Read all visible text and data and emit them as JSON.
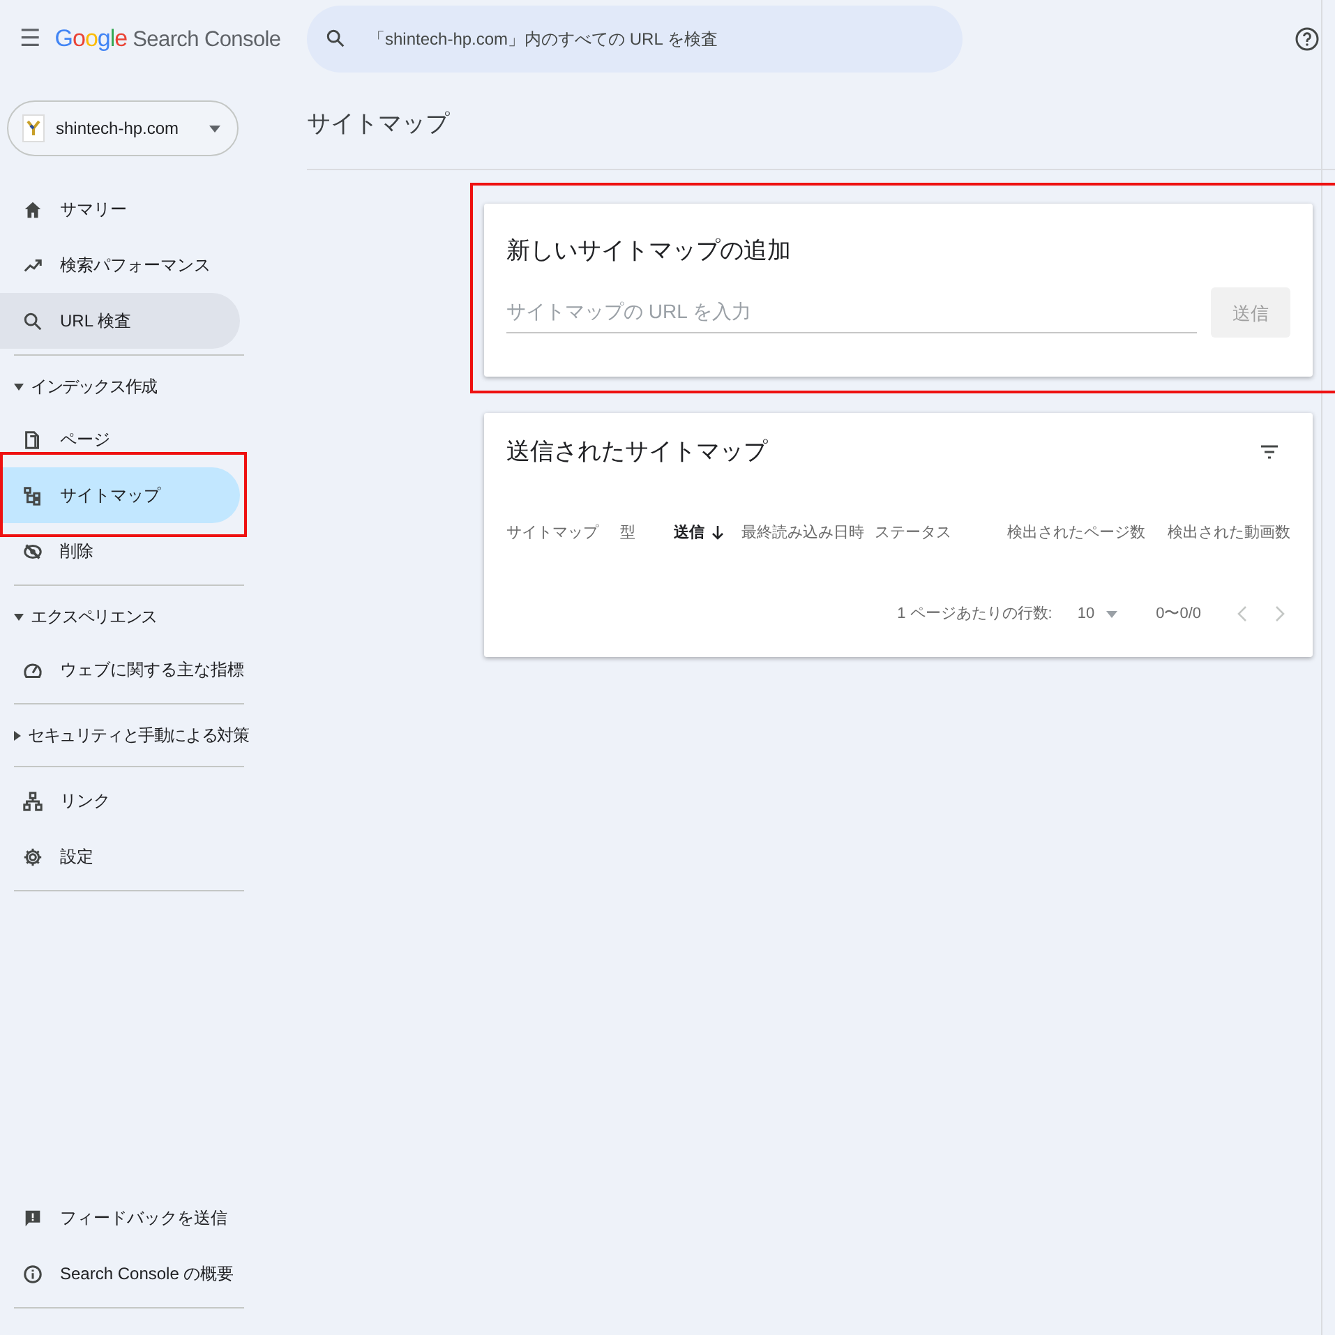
{
  "header": {
    "menu_glyph": "☰",
    "logo": [
      {
        "text": "G",
        "color": "#4285f4"
      },
      {
        "text": "o",
        "color": "#ea4335"
      },
      {
        "text": "o",
        "color": "#fbbc05"
      },
      {
        "text": "g",
        "color": "#4285f4"
      },
      {
        "text": "l",
        "color": "#34a853"
      },
      {
        "text": "e",
        "color": "#ea4335"
      }
    ],
    "product": "Search Console",
    "search": {
      "placeholder": "「shintech-hp.com」内のすべての URL を検査"
    }
  },
  "property": {
    "name": "shintech-hp.com"
  },
  "nav": [
    {
      "kind": "item",
      "label": "サマリー",
      "selected": false,
      "hovered": false,
      "highlighted": false
    },
    {
      "kind": "item",
      "label": "検索パフォーマンス",
      "selected": false,
      "hovered": false,
      "highlighted": false
    },
    {
      "kind": "item",
      "label": "URL 検査",
      "selected": false,
      "hovered": true,
      "highlighted": false
    },
    {
      "kind": "divider"
    },
    {
      "kind": "section",
      "label": "インデックス作成",
      "expanded": true
    },
    {
      "kind": "item",
      "label": "ページ",
      "selected": false,
      "hovered": false,
      "highlighted": false
    },
    {
      "kind": "item",
      "label": "サイトマップ",
      "selected": true,
      "hovered": false,
      "highlighted": true
    },
    {
      "kind": "item",
      "label": "削除",
      "selected": false,
      "hovered": false,
      "highlighted": false
    },
    {
      "kind": "divider"
    },
    {
      "kind": "section",
      "label": "エクスペリエンス",
      "expanded": true
    },
    {
      "kind": "item",
      "label": "ウェブに関する主な指標",
      "selected": false,
      "hovered": false,
      "highlighted": false
    },
    {
      "kind": "divider"
    },
    {
      "kind": "section",
      "label": "セキュリティと手動による対策",
      "expanded": false
    },
    {
      "kind": "divider"
    },
    {
      "kind": "item",
      "label": "リンク",
      "selected": false,
      "hovered": false,
      "highlighted": false
    },
    {
      "kind": "item",
      "label": "設定",
      "selected": false,
      "hovered": false,
      "highlighted": false
    },
    {
      "kind": "divider"
    }
  ],
  "footer_nav": [
    {
      "label": "フィードバックを送信"
    },
    {
      "label": "Search Console の概要"
    }
  ],
  "page_title": "サイトマップ",
  "add_sitemap": {
    "title": "新しいサイトマップの追加",
    "highlighted": true,
    "input": {
      "placeholder": "サイトマップの URL を入力"
    },
    "submit": {
      "label": "送信",
      "disabled": true
    }
  },
  "submitted": {
    "title": "送信されたサイトマップ",
    "columns": [
      {
        "label": "サイトマップ",
        "sorted": false
      },
      {
        "label": "型",
        "sorted": false
      },
      {
        "label": "送信",
        "sorted": true
      },
      {
        "label": "最終読み込み日時",
        "sorted": false
      },
      {
        "label": "ステータス",
        "sorted": false
      },
      {
        "label": "検出されたページ数",
        "sorted": false
      },
      {
        "label": "検出された動画数",
        "sorted": false
      }
    ],
    "pagination": {
      "rows_label": "1 ページあたりの行数:",
      "rows_value": "10",
      "range": "0〜0/0",
      "prev_disabled": true,
      "next_disabled": true
    }
  }
}
